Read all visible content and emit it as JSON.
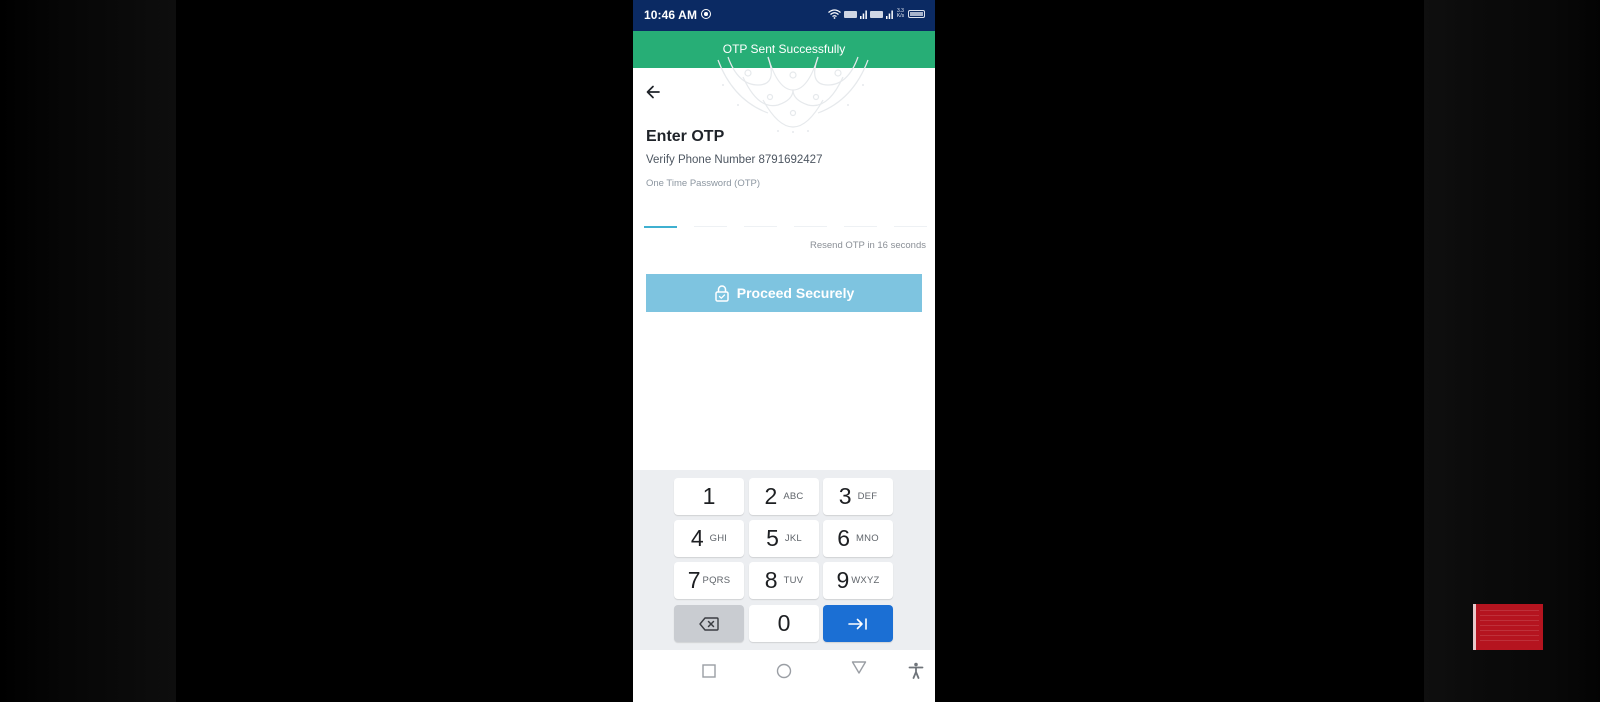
{
  "status_bar": {
    "time": "10:46 AM",
    "icons": [
      "screen-record-icon",
      "wifi-icon",
      "volte-icon",
      "signal-icon",
      "volte-icon",
      "signal-icon",
      "network-speed-icon",
      "battery-icon"
    ],
    "network_speed": "3.3 K/s"
  },
  "toast": {
    "message": "OTP Sent Successfully",
    "color": "#27ae76"
  },
  "header": {
    "back_icon": "arrow-left-icon",
    "title": "Enter OTP",
    "subtitle": "Verify Phone Number 8791692427"
  },
  "otp": {
    "label": "One Time Password (OTP)",
    "digits": [
      "",
      "",
      "",
      "",
      "",
      ""
    ],
    "active_index": 0,
    "resend_text": "Resend OTP in 16 seconds"
  },
  "proceed_button": {
    "label": "Proceed Securely",
    "icon": "lock-icon",
    "color": "#7ec4e0"
  },
  "keypad": {
    "keys": [
      {
        "num": "1",
        "letters": ""
      },
      {
        "num": "2",
        "letters": "ABC"
      },
      {
        "num": "3",
        "letters": "DEF"
      },
      {
        "num": "4",
        "letters": "GHI"
      },
      {
        "num": "5",
        "letters": "JKL"
      },
      {
        "num": "6",
        "letters": "MNO"
      },
      {
        "num": "7",
        "letters": "PQRS"
      },
      {
        "num": "8",
        "letters": "TUV"
      },
      {
        "num": "9",
        "letters": "WXYZ"
      },
      {
        "num": "backspace",
        "letters": ""
      },
      {
        "num": "0",
        "letters": ""
      },
      {
        "num": "next",
        "letters": ""
      }
    ],
    "next_color": "#1b6fd4"
  },
  "nav_bar": {
    "buttons": [
      "recents-icon",
      "home-icon",
      "back-icon",
      "accessibility-icon"
    ]
  }
}
